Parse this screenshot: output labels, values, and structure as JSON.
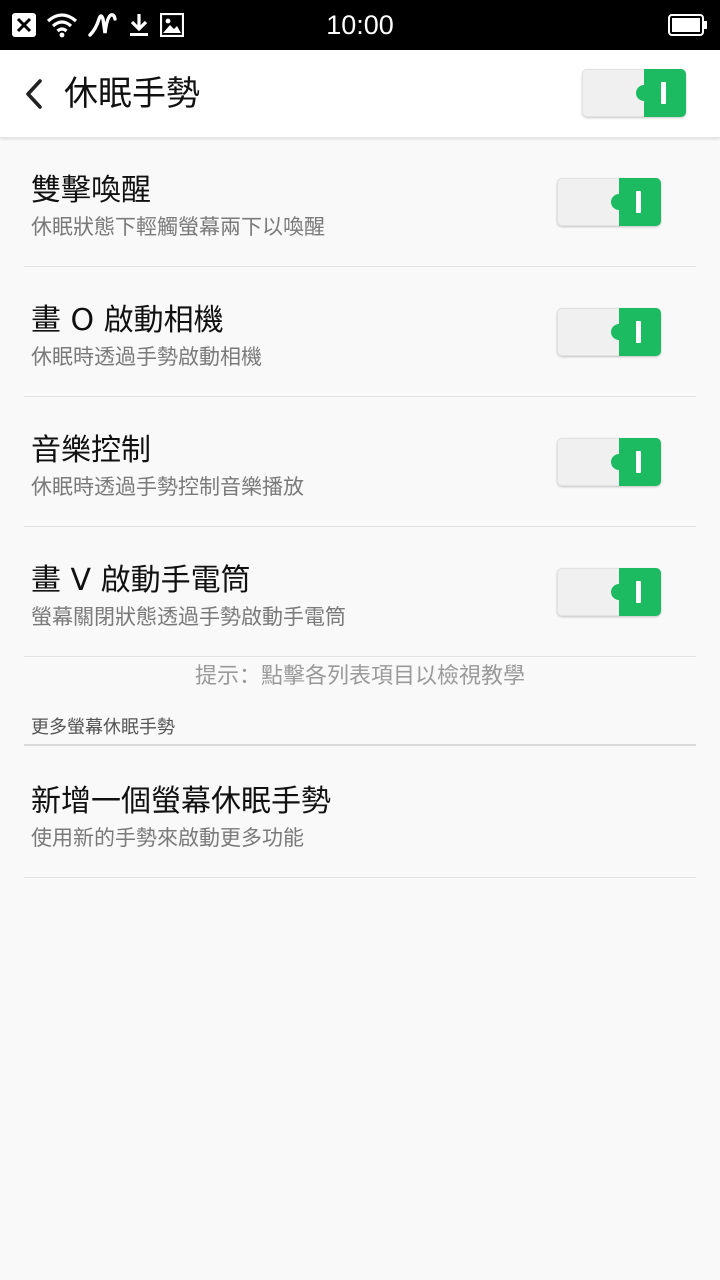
{
  "status_bar": {
    "time": "10:00",
    "icons": [
      "close-box-icon",
      "wifi-icon",
      "gesture-icon",
      "download-icon",
      "image-icon",
      "battery-icon"
    ]
  },
  "header": {
    "title": "休眠手勢",
    "master_toggle_on": true
  },
  "colors": {
    "accent": "#1dbb61",
    "background": "#f9f9f9"
  },
  "items": [
    {
      "title": "雙擊喚醒",
      "subtitle": "休眠狀態下輕觸螢幕兩下以喚醒",
      "on": true
    },
    {
      "title": "畫 O 啟動相機",
      "subtitle": "休眠時透過手勢啟動相機",
      "on": true
    },
    {
      "title": "音樂控制",
      "subtitle": "休眠時透過手勢控制音樂播放",
      "on": true
    },
    {
      "title": "畫 V 啟動手電筒",
      "subtitle": "螢幕關閉狀態透過手勢啟動手電筒",
      "on": true
    }
  ],
  "hint": "提示：點擊各列表項目以檢視教學",
  "more_section": {
    "header": "更多螢幕休眠手勢",
    "add_item": {
      "title": "新增一個螢幕休眠手勢",
      "subtitle": "使用新的手勢來啟動更多功能"
    }
  }
}
